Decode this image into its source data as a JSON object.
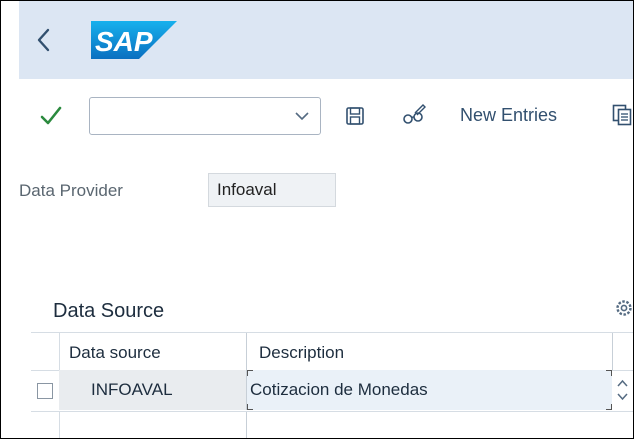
{
  "header": {
    "logo_text": "SAP",
    "brand_color": "#1d8fd8",
    "background": "#dce6f3"
  },
  "toolbar": {
    "command_field_value": "",
    "new_entries_label": "New Entries",
    "accent_check_color": "#2b8a3e"
  },
  "form": {
    "data_provider_label": "Data Provider",
    "data_provider_value": "Infoaval"
  },
  "table": {
    "title": "Data Source",
    "columns": [
      "Data source",
      "Description"
    ],
    "rows": [
      {
        "data_source": "INFOAVAL",
        "description": "Cotizacion de Monedas"
      }
    ]
  },
  "icons": {
    "back": "chevron-left-icon",
    "check": "check-icon",
    "save": "save-icon",
    "display_change": "glasses-icon",
    "copy": "copy-icon",
    "settings": "settings-icon"
  }
}
